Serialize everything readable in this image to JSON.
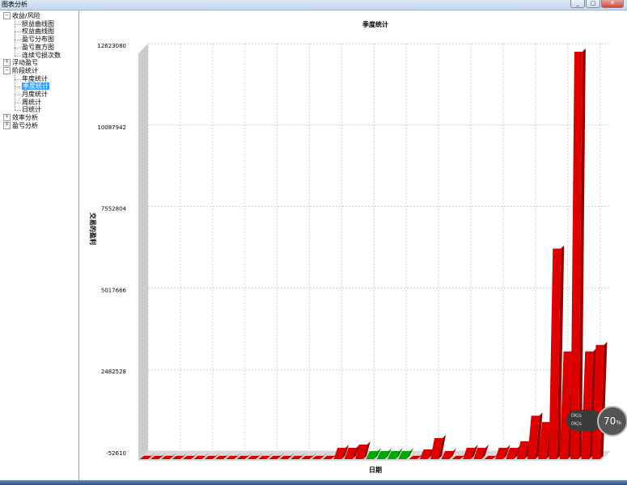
{
  "window": {
    "title": "图表分析"
  },
  "tree": [
    {
      "label": "收益/风险",
      "level": 0,
      "expander": "−"
    },
    {
      "label": "损益曲线图",
      "level": 1
    },
    {
      "label": "权益曲线图",
      "level": 1
    },
    {
      "label": "盈亏分布图",
      "level": 1
    },
    {
      "label": "盈亏直方图",
      "level": 1
    },
    {
      "label": "连续亏损次数",
      "level": 1
    },
    {
      "label": "浮动盈亏",
      "level": 0,
      "expander": "+"
    },
    {
      "label": "阶段统计",
      "level": 0,
      "expander": "−"
    },
    {
      "label": "年度统计",
      "level": 1
    },
    {
      "label": "季度统计",
      "level": 1,
      "selected": true
    },
    {
      "label": "月度统计",
      "level": 1
    },
    {
      "label": "周统计",
      "level": 1
    },
    {
      "label": "日统计",
      "level": 1
    },
    {
      "label": "效率分析",
      "level": 0,
      "expander": "+"
    },
    {
      "label": "盈亏分析",
      "level": 0,
      "expander": "+"
    }
  ],
  "chart_data": {
    "type": "bar",
    "title": "季度统计",
    "xlabel": "日期",
    "ylabel": "交易的盈利",
    "yticks": [
      "12623080",
      "10087942",
      "7552804",
      "5017666",
      "2482528",
      "-52610"
    ],
    "ylim": [
      -52610,
      12623080
    ],
    "values": [
      50000,
      50000,
      50000,
      50000,
      50000,
      50000,
      50000,
      50000,
      50000,
      50000,
      50000,
      50000,
      50000,
      50000,
      50000,
      50000,
      50000,
      50000,
      300000,
      300000,
      400000,
      -40000,
      -40000,
      -40000,
      -40000,
      50000,
      250000,
      600000,
      200000,
      50000,
      300000,
      300000,
      50000,
      300000,
      300000,
      500000,
      1300000,
      1100000,
      6500000,
      3300000,
      12623080,
      3300000,
      3500000
    ],
    "positive_color": "#dd0000",
    "negative_color": "#00aa00"
  },
  "overlay": {
    "gauge_value": "70",
    "gauge_unit": "%",
    "up_speed": "0K/s",
    "down_speed": "0K/s"
  }
}
